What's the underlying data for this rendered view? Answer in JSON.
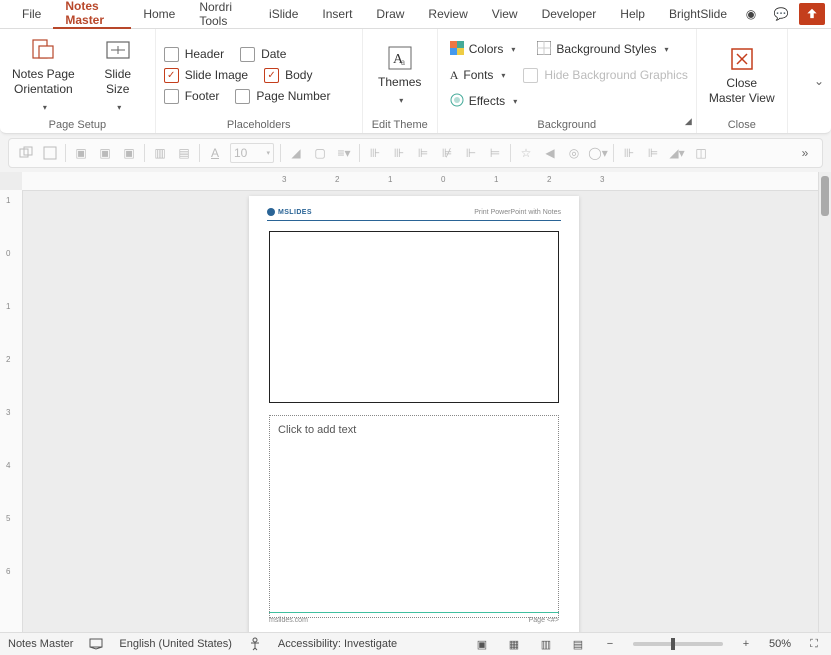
{
  "menubar": {
    "tabs": [
      "File",
      "Notes Master",
      "Home",
      "Nordri Tools",
      "iSlide",
      "Insert",
      "Draw",
      "Review",
      "View",
      "Developer",
      "Help",
      "BrightSlide"
    ],
    "active_index": 1
  },
  "ribbon": {
    "page_setup": {
      "label": "Page Setup",
      "orientation_label": "Notes Page\nOrientation",
      "slide_size_label": "Slide\nSize"
    },
    "placeholders": {
      "label": "Placeholders",
      "header": "Header",
      "date": "Date",
      "slide_image": "Slide Image",
      "body": "Body",
      "footer": "Footer",
      "page_number": "Page Number",
      "checked": {
        "header": false,
        "date": false,
        "slide_image": true,
        "body": true,
        "footer": false,
        "page_number": false
      }
    },
    "edit_theme": {
      "label": "Edit Theme",
      "themes_label": "Themes"
    },
    "background": {
      "label": "Background",
      "colors": "Colors",
      "fonts": "Fonts",
      "effects": "Effects",
      "styles": "Background Styles",
      "hide": "Hide Background Graphics"
    },
    "close": {
      "label": "Close",
      "btn": "Close\nMaster View"
    }
  },
  "qat": {
    "font_size": "10"
  },
  "ruler": {
    "h": [
      "3",
      "2",
      "1",
      "0",
      "1",
      "2",
      "3"
    ],
    "v": [
      "1",
      "0",
      "1",
      "2",
      "3",
      "4",
      "5",
      "6"
    ]
  },
  "page": {
    "logo_text": "MSLIDES",
    "header_right": "Print PowerPoint with Notes",
    "notes_placeholder": "Click to add text",
    "footer_left": "mslides.com",
    "footer_right": "Page <#>"
  },
  "statusbar": {
    "view_label": "Notes Master",
    "language": "English (United States)",
    "accessibility": "Accessibility: Investigate",
    "zoom": "50%"
  }
}
